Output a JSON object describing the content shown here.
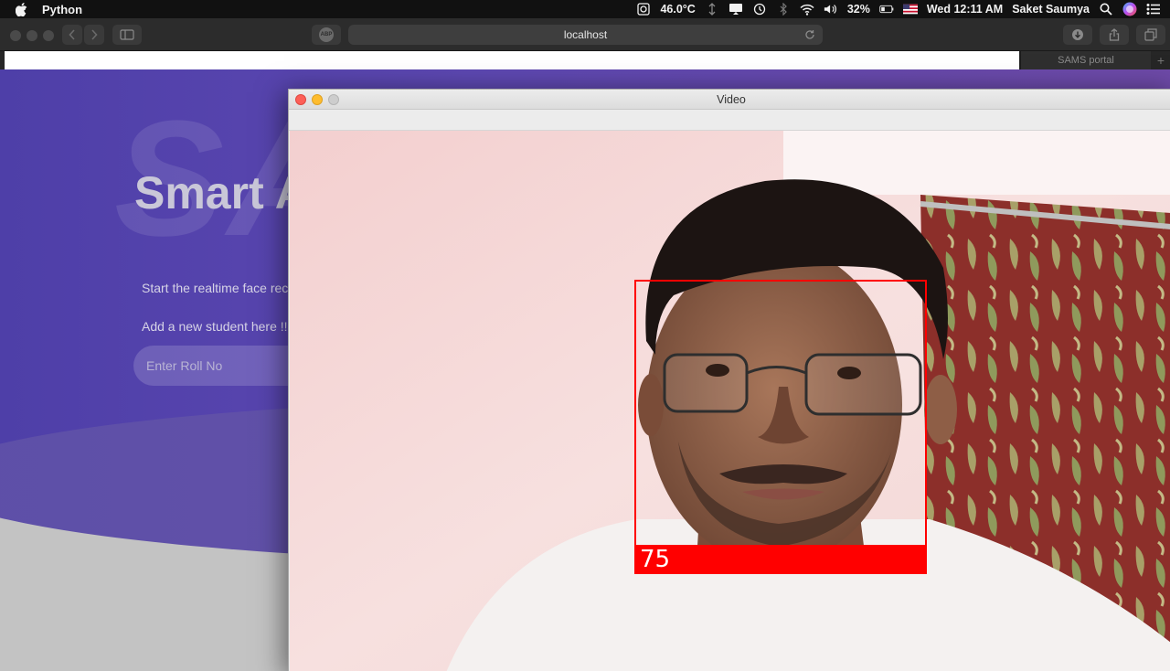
{
  "menubar": {
    "app_name": "Python",
    "temperature": "46.0°C",
    "battery": "32%",
    "datetime": "Wed 12:11 AM",
    "user": "Saket Saumya",
    "icons": [
      "apple-icon",
      "fan-icon",
      "sync-icon",
      "display-icon",
      "time-machine-icon",
      "bluetooth-icon",
      "wifi-icon",
      "volume-icon",
      "battery-icon",
      "flag-icon",
      "search-icon",
      "siri-icon",
      "notification-center-icon"
    ]
  },
  "browser": {
    "url": "localhost",
    "adblock_label": "ABP",
    "tabs": [
      {
        "label": "SAMS portal"
      }
    ]
  },
  "page": {
    "bg_letters": "SA",
    "title": "Smart A",
    "line1": "Start the realtime face reco",
    "line2": "Add a new student here !!",
    "roll_placeholder": "Enter Roll No",
    "colors": {
      "hero_start": "#4e3fa8",
      "hero_end": "#6e4aa8",
      "page_bg": "#c3c3c3"
    }
  },
  "video_window": {
    "title": "Video",
    "confidence": "75",
    "box_color": "#ff0000"
  }
}
